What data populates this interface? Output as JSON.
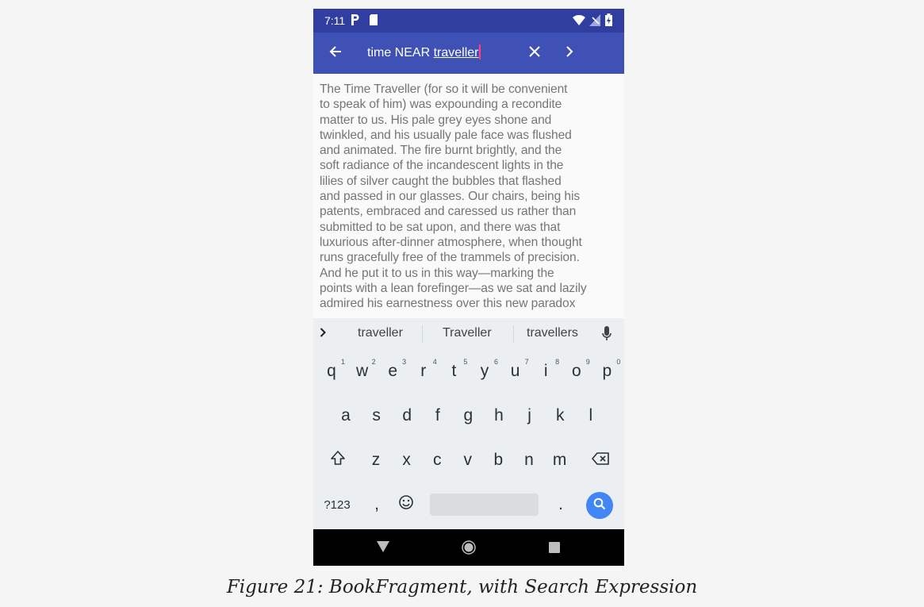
{
  "status_bar": {
    "time": "7:11"
  },
  "toolbar": {
    "query_prefix": "time NEAR ",
    "query_word": "traveller"
  },
  "content": {
    "lines": [
      "The Time Traveller (for so it will be convenient",
      "to speak of him) was expounding a recondite",
      "matter to us. His pale grey eyes shone and",
      "twinkled, and his usually pale face was flushed",
      "and animated. The fire burnt brightly, and the",
      "soft radiance of the incandescent lights in the",
      "lilies of silver caught the bubbles that flashed",
      "and passed in our glasses. Our chairs, being his",
      "patents, embraced and caressed us rather than",
      "submitted to be sat upon, and there was that",
      "luxurious after-dinner atmosphere, when thought",
      "runs gracefully free of the trammels of precision.",
      "And he put it to us in this way—marking the",
      "points with a lean forefinger—as we sat and lazily",
      "admired his earnestness over this new paradox"
    ]
  },
  "suggestions": {
    "items": [
      "traveller",
      "Traveller",
      "travellers"
    ]
  },
  "keyboard": {
    "row1": [
      {
        "key": "q",
        "hint": "1"
      },
      {
        "key": "w",
        "hint": "2"
      },
      {
        "key": "e",
        "hint": "3"
      },
      {
        "key": "r",
        "hint": "4"
      },
      {
        "key": "t",
        "hint": "5"
      },
      {
        "key": "y",
        "hint": "6"
      },
      {
        "key": "u",
        "hint": "7"
      },
      {
        "key": "i",
        "hint": "8"
      },
      {
        "key": "o",
        "hint": "9"
      },
      {
        "key": "p",
        "hint": "0"
      }
    ],
    "row2": [
      "a",
      "s",
      "d",
      "f",
      "g",
      "h",
      "j",
      "k",
      "l"
    ],
    "row3": [
      "z",
      "x",
      "c",
      "v",
      "b",
      "n",
      "m"
    ],
    "symbols_label": "?123",
    "comma_label": ",",
    "period_label": "."
  },
  "caption": "Figure 21: BookFragment, with Search Expression",
  "colors": {
    "status_bar": "#303f9f",
    "toolbar": "#3f51b5",
    "caret": "#ff4081",
    "search_key": "#4285f4",
    "keyboard_bg": "#eceff1"
  },
  "icons": [
    "parking-icon",
    "sd-card-icon",
    "wifi-icon",
    "no-signal-icon",
    "battery-icon",
    "back-arrow-icon",
    "close-icon",
    "chevron-right-icon",
    "expand-chevron-icon",
    "microphone-icon",
    "shift-icon",
    "backspace-icon",
    "emoji-icon",
    "search-icon",
    "nav-back-icon",
    "nav-home-icon",
    "nav-recents-icon"
  ]
}
